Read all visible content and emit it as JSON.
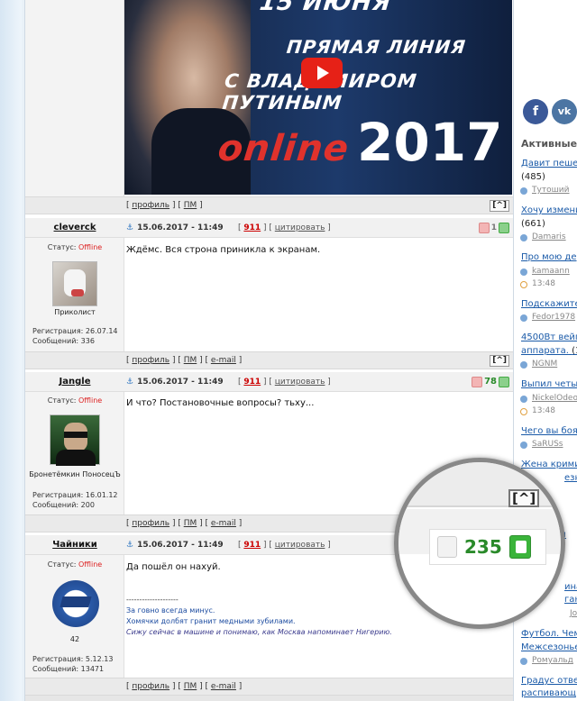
{
  "video": {
    "top_line": "15 ИЮНЯ",
    "line1": "ПРЯМАЯ ЛИНИЯ",
    "line2": "С ВЛАДИМИРОМ ПУТИНЫМ",
    "online": "online",
    "year": "2017"
  },
  "links": {
    "profile": "профиль",
    "pm": "ПМ",
    "email": "e-mail",
    "quote": "цитировать",
    "up": "[^]"
  },
  "status_label": "Статус:",
  "offline": "Offline",
  "reg_label": "Регистрация:",
  "msgs_label": "Сообщений:",
  "posts": [
    {
      "user": "cleverck",
      "date": "15.06.2017 - 11:49",
      "num": "911",
      "rating": "1",
      "rank": "Приколист",
      "reg": "26.07.14",
      "msgs": "336",
      "text": "Ждёмс. Вся строна приникла к экранам."
    },
    {
      "user": "Jangle",
      "date": "15.06.2017 - 11:49",
      "num": "911",
      "rating": "78",
      "rank": "Бронетёмкин ПоносецЪ",
      "reg": "16.01.12",
      "msgs": "200",
      "text": "И что? Постановочные вопросы? тьху..."
    },
    {
      "user": "Чайники",
      "date": "15.06.2017 - 11:49",
      "num": "911",
      "rating": "235",
      "rank": "42",
      "reg": "5.12.13",
      "msgs": "13471",
      "text": "Да пошёл он нахуй.",
      "sig_sep": "--------------------",
      "sig1": "За говно всегда минус.",
      "sig2": "Хомячки долбят гранит медными зубилами.",
      "sig3": "Сижу сейчас в машине и понимаю, как Москва напоминает Нигерию."
    }
  ],
  "sidebar": {
    "fb": "f",
    "vk": "vk",
    "title": "Активные",
    "items": [
      {
        "title": "Давит пешеход",
        "count": "(485)",
        "user": "Тутоший"
      },
      {
        "title": "Хочу изменить",
        "count": "(661)",
        "user": "Damaris"
      },
      {
        "title": "Про мою дер",
        "user": "kamaann",
        "time": "13:48"
      },
      {
        "title": "Подскажите",
        "user": "Fedor1978"
      },
      {
        "title": "4500Вт вейп",
        "title2": "аппарата.",
        "count": "(1",
        "user": "NGNM"
      },
      {
        "title": "Выпил четыр",
        "user": "NickelOdeo",
        "time": "13:48"
      },
      {
        "title": "Чего вы боял",
        "user": "SaRUSs"
      },
      {
        "title": "Жена кримин",
        "title2": "езнодор"
      },
      {
        "title": "ч"
      },
      {
        "title": "ина во"
      },
      {
        "title": "гаю..."
      },
      {
        "user": "Johan"
      },
      {
        "title": "Футбол. Чемп",
        "title2": "Межсезонье."
      },
      {
        "user": "Ромуальд"
      },
      {
        "title": "Градус ответ",
        "title2": "распивающ"
      }
    ]
  }
}
